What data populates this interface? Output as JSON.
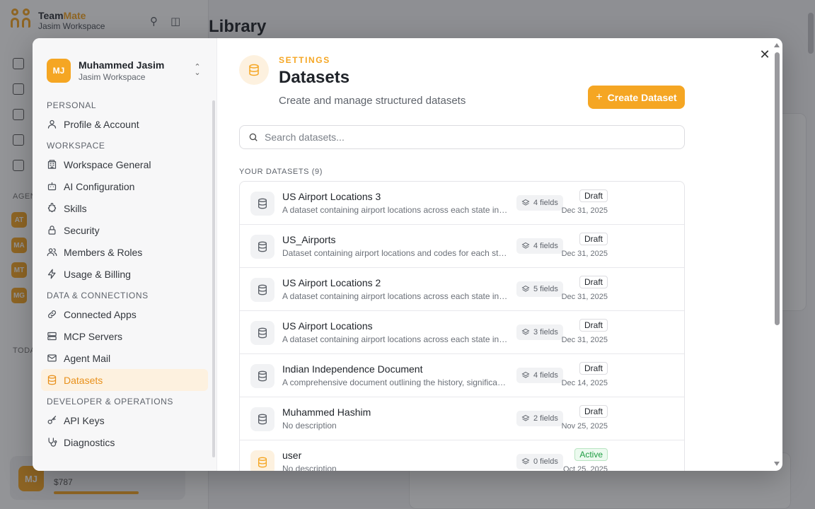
{
  "background": {
    "brand": {
      "name_a": "Team",
      "name_b": "Mate",
      "workspace": "Jasim Workspace"
    },
    "page_title": "Library",
    "footer": {
      "avatar": "MJ",
      "balance": "$787"
    },
    "agents": [
      "AT",
      "MA",
      "MT",
      "MG"
    ],
    "section_agents": "AGEN",
    "section_today": "TODA"
  },
  "modal": {
    "user": {
      "initials": "MJ",
      "name": "Muhammed Jasim",
      "workspace": "Jasim Workspace"
    },
    "sections": [
      {
        "title": "PERSONAL",
        "items": [
          {
            "label": "Profile & Account",
            "icon": "user-icon"
          }
        ]
      },
      {
        "title": "WORKSPACE",
        "items": [
          {
            "label": "Workspace General",
            "icon": "building-icon"
          },
          {
            "label": "AI Configuration",
            "icon": "bot-icon"
          },
          {
            "label": "Skills",
            "icon": "puzzle-icon"
          },
          {
            "label": "Security",
            "icon": "lock-icon"
          },
          {
            "label": "Members & Roles",
            "icon": "users-icon"
          },
          {
            "label": "Usage & Billing",
            "icon": "bolt-icon"
          }
        ]
      },
      {
        "title": "DATA & CONNECTIONS",
        "items": [
          {
            "label": "Connected Apps",
            "icon": "link-icon"
          },
          {
            "label": "MCP Servers",
            "icon": "server-icon"
          },
          {
            "label": "Agent Mail",
            "icon": "mail-icon"
          },
          {
            "label": "Datasets",
            "icon": "database-icon",
            "active": true
          }
        ]
      },
      {
        "title": "DEVELOPER & OPERATIONS",
        "items": [
          {
            "label": "API Keys",
            "icon": "key-icon"
          },
          {
            "label": "Diagnostics",
            "icon": "stethoscope-icon"
          }
        ]
      }
    ],
    "header": {
      "eyebrow": "SETTINGS",
      "title": "Datasets",
      "subtitle": "Create and manage structured datasets",
      "create_label": "Create Dataset"
    },
    "search": {
      "placeholder": "Search datasets...",
      "value": ""
    },
    "list_label": "YOUR DATASETS (9)",
    "datasets": [
      {
        "name": "US Airport Locations 3",
        "description": "A dataset containing airport locations across each state in the United States",
        "fields": "4 fields",
        "status": "Draft",
        "date": "Dec 31, 2025"
      },
      {
        "name": "US_Airports",
        "description": "Dataset containing airport locations and codes for each state",
        "fields": "4 fields",
        "status": "Draft",
        "date": "Dec 31, 2025"
      },
      {
        "name": "US Airport Locations 2",
        "description": "A dataset containing airport locations across each state in the United States",
        "fields": "5 fields",
        "status": "Draft",
        "date": "Dec 31, 2025"
      },
      {
        "name": "US Airport Locations",
        "description": "A dataset containing airport locations across each state in the United States",
        "fields": "3 fields",
        "status": "Draft",
        "date": "Dec 31, 2025"
      },
      {
        "name": "Indian Independence Document",
        "description": "A comprehensive document outlining the history, significance and events",
        "fields": "4 fields",
        "status": "Draft",
        "date": "Dec 14, 2025"
      },
      {
        "name": "Muhammed Hashim",
        "description": "No description",
        "fields": "2 fields",
        "status": "Draft",
        "date": "Nov 25, 2025"
      },
      {
        "name": "user",
        "description": "No description",
        "fields": "0 fields",
        "status": "Active",
        "date": "Oct 25, 2025"
      }
    ],
    "colors": {
      "accent": "#f5a623",
      "active_bg": "#fdf1df",
      "active_text": "#1f9d43"
    }
  }
}
